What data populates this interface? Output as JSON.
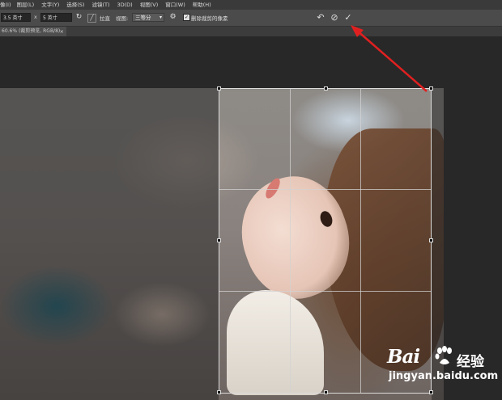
{
  "menu": [
    "像(I)",
    "图层(L)",
    "文字(Y)",
    "选择(S)",
    "滤镜(T)",
    "3D(D)",
    "视图(V)",
    "窗口(W)",
    "帮助(H)"
  ],
  "options": {
    "width_value": "3.5 英寸",
    "times": "x",
    "height_value": "5 英寸",
    "straighten_label": "拉直",
    "view_label": "视图:",
    "view_value": "三等分",
    "delete_cropped_label": "删除裁剪的像素",
    "delete_cropped_checked": true
  },
  "tab": {
    "label": "60.6% (裁剪预览, RGB/8)",
    "close": "×"
  },
  "watermark": {
    "brand": "Bai",
    "cn": "经验",
    "url": "jingyan.baidu.com"
  },
  "colors": {
    "arrow": "#e02020",
    "workspace": "#282828",
    "options_bar": "#4b4b4b"
  },
  "icons": {
    "rotate": "rotate-icon",
    "reset": "reset-icon",
    "cancel": "cancel-icon",
    "commit": "checkmark-icon",
    "straighten": "straighten-icon",
    "gear": "gear-icon"
  }
}
